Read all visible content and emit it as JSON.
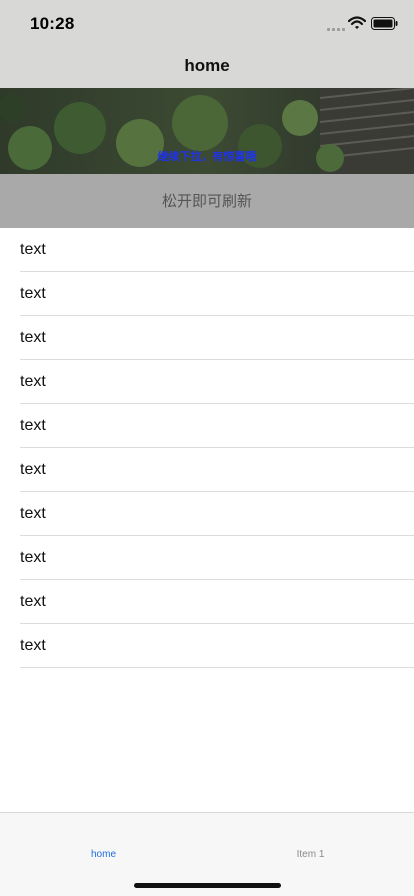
{
  "status_bar": {
    "time": "10:28",
    "icons": [
      "signal-icon",
      "wifi-icon",
      "battery-icon"
    ]
  },
  "nav": {
    "title": "home"
  },
  "banner": {
    "text": "继续下拉，有惊喜哦",
    "text_color": "#1f33e8"
  },
  "refresh": {
    "label": "松开即可刷新"
  },
  "list": {
    "items": [
      {
        "label": "text"
      },
      {
        "label": "text"
      },
      {
        "label": "text"
      },
      {
        "label": "text"
      },
      {
        "label": "text"
      },
      {
        "label": "text"
      },
      {
        "label": "text"
      },
      {
        "label": "text"
      },
      {
        "label": "text"
      },
      {
        "label": "text"
      }
    ]
  },
  "tab_bar": {
    "tabs": [
      {
        "label": "home",
        "selected": true
      },
      {
        "label": "Item 1",
        "selected": false
      }
    ],
    "accent_color": "#1f6fe0"
  }
}
